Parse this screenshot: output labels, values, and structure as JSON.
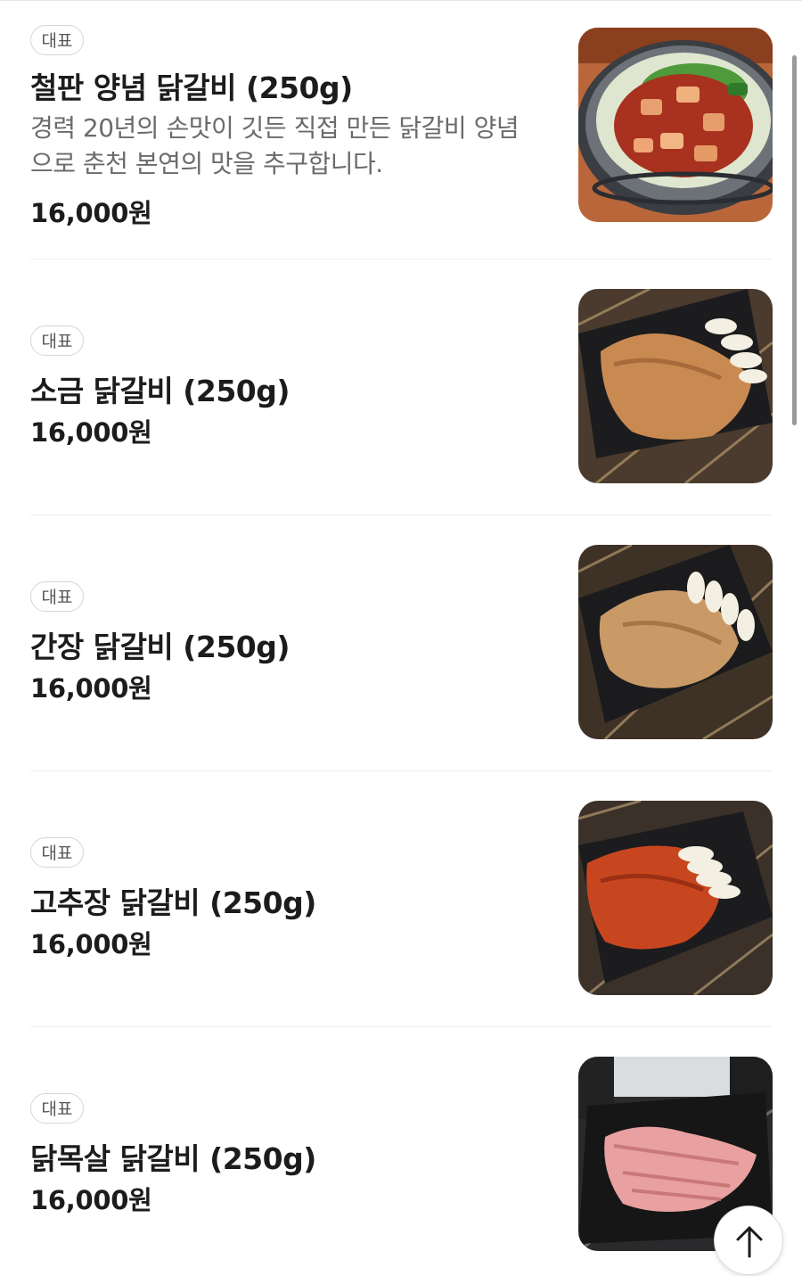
{
  "menu": {
    "items": [
      {
        "badge": "대표",
        "name": "철판 양념 닭갈비 (250g)",
        "description_lines": [
          "경력 20년의 손맛이 깃든 직접 만든 닭갈비 양념",
          "으로 춘천 본연의 맛을 추구합니다."
        ],
        "price": "16,000원",
        "photo": "spicy-dakgalbi-iron-pan-photo"
      },
      {
        "badge": "대표",
        "name": "소금 닭갈비 (250g)",
        "price": "16,000원",
        "photo": "salt-dakgalbi-photo"
      },
      {
        "badge": "대표",
        "name": "간장 닭갈비 (250g)",
        "price": "16,000원",
        "photo": "soy-dakgalbi-photo"
      },
      {
        "badge": "대표",
        "name": "고추장 닭갈비 (250g)",
        "price": "16,000원",
        "photo": "gochujang-dakgalbi-photo"
      },
      {
        "badge": "대표",
        "name": "닭목살 닭갈비 (250g)",
        "price": "16,000원",
        "photo": "chicken-neck-dakgalbi-photo"
      }
    ]
  },
  "controls": {
    "scroll_top_icon": "arrow-up-icon"
  },
  "colors": {
    "text_primary": "#1c1c1c",
    "text_secondary": "#6b6b6b",
    "badge_border": "#d6d6d6",
    "divider": "#eeeeee"
  }
}
